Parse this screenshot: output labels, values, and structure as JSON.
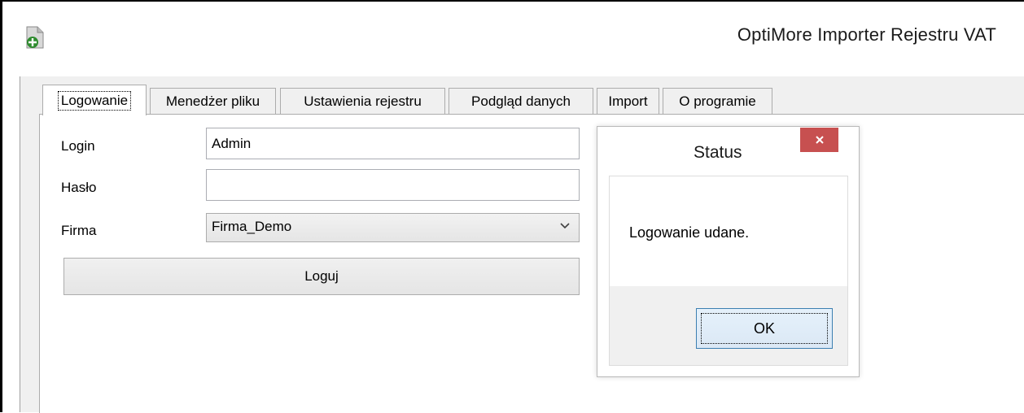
{
  "window": {
    "title": "OptiMore Importer Rejestru VAT",
    "icon": "app-icon"
  },
  "tabs": [
    {
      "label": "Logowanie",
      "active": true
    },
    {
      "label": "Menedżer pliku",
      "active": false
    },
    {
      "label": "Ustawienia rejestru",
      "active": false
    },
    {
      "label": "Podgląd danych",
      "active": false
    },
    {
      "label": "Import",
      "active": false
    },
    {
      "label": "O programie",
      "active": false
    }
  ],
  "login_form": {
    "login_label": "Login",
    "login_value": "Admin",
    "password_label": "Hasło",
    "password_value": "",
    "company_label": "Firma",
    "company_value": "Firma_Demo",
    "submit_label": "Loguj"
  },
  "status_dialog": {
    "title": "Status",
    "close_icon": "close-icon",
    "message": "Logowanie udane.",
    "ok_label": "OK"
  },
  "colors": {
    "close_button": "#c75050",
    "ok_border": "#3c7fb1"
  }
}
